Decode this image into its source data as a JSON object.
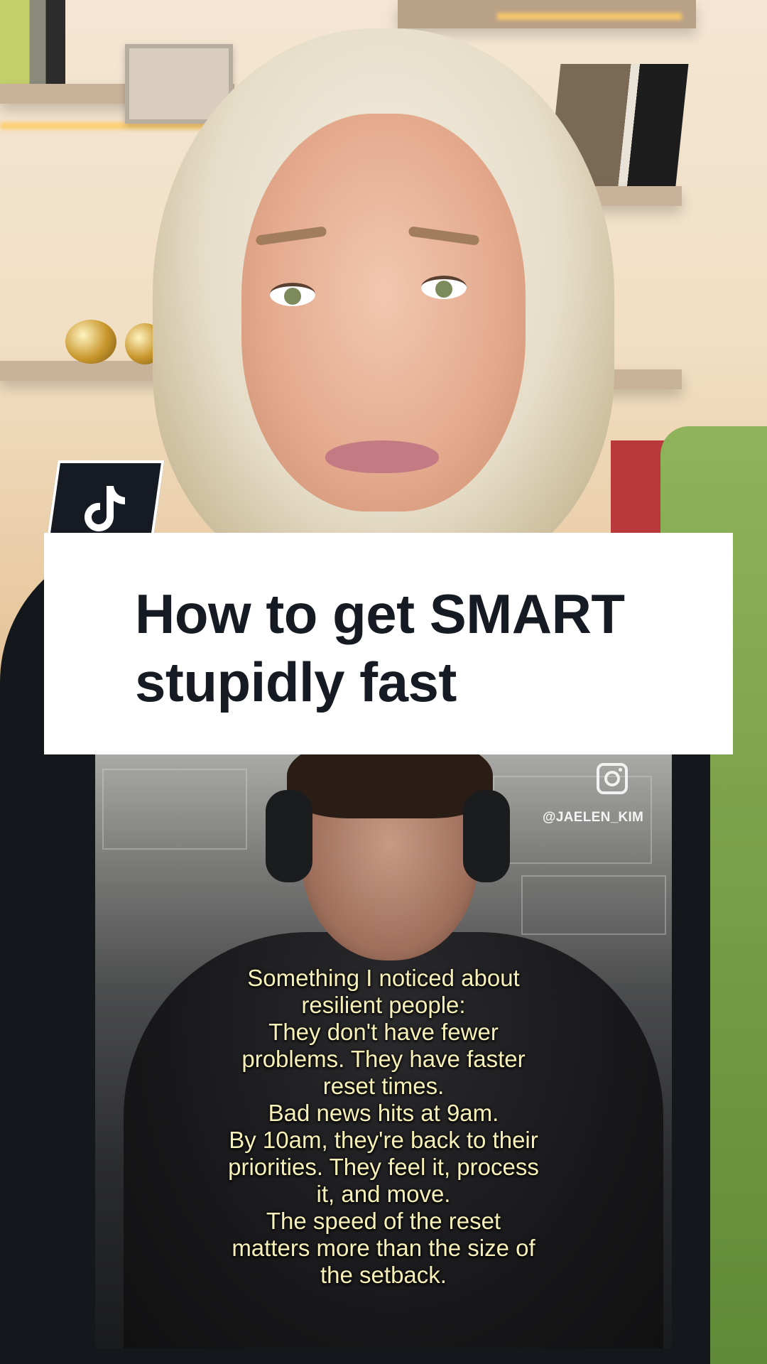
{
  "overlay": {
    "title": "How to get SMART\nstupidly fast",
    "app_logo": "tiktok-logo"
  },
  "embedded_video": {
    "watermark_handle": "@JAELEN_KIM",
    "watermark_icon": "instagram-icon",
    "caption_lines": [
      "Something I noticed about",
      "resilient people:",
      "They don't have fewer",
      "problems. They have faster",
      "reset times.",
      "Bad news hits at 9am.",
      "By 10am, they're back to their",
      "priorities. They feel it, process",
      "it, and move.",
      "The speed of the reset",
      "matters more than the size of",
      "the setback."
    ]
  },
  "colors": {
    "title_text": "#161a22",
    "caption_text": "#f7f0b8",
    "tile_bg": "#161a22"
  }
}
